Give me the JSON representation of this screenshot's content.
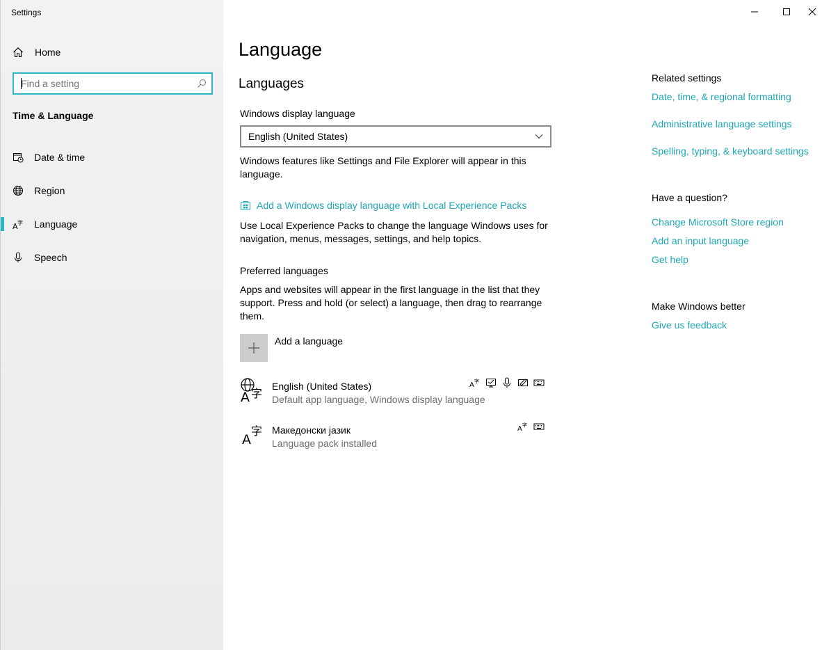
{
  "window": {
    "title": "Settings"
  },
  "sidebar": {
    "home_label": "Home",
    "search_placeholder": "Find a setting",
    "section_title": "Time & Language",
    "items": [
      {
        "label": "Date & time",
        "icon": "calendar-clock-icon"
      },
      {
        "label": "Region",
        "icon": "globe-icon"
      },
      {
        "label": "Language",
        "icon": "language-icon",
        "selected": true
      },
      {
        "label": "Speech",
        "icon": "microphone-icon"
      }
    ]
  },
  "main": {
    "page_title": "Language",
    "section_title": "Languages",
    "display_language": {
      "label": "Windows display language",
      "selected": "English (United States)",
      "description": "Windows features like Settings and File Explorer will appear in this language."
    },
    "local_experience": {
      "link": "Add a Windows display language with Local Experience Packs",
      "description": "Use Local Experience Packs to change the language Windows uses for navigation, menus, messages, settings, and help topics."
    },
    "preferred": {
      "label": "Preferred languages",
      "description": "Apps and websites will appear in the first language in the list that they support. Press and hold (or select) a language, then drag to rearrange them.",
      "add_label": "Add a language",
      "languages": [
        {
          "name": "English (United States)",
          "status": "Default app language, Windows display language"
        },
        {
          "name": "Македонски јазик",
          "status": "Language pack installed"
        }
      ]
    }
  },
  "related": {
    "title": "Related settings",
    "links": [
      "Date, time, & regional formatting",
      "Administrative language settings",
      "Spelling, typing, & keyboard settings"
    ]
  },
  "question": {
    "title": "Have a question?",
    "links": [
      "Change Microsoft Store region",
      "Add an input language",
      "Get help"
    ]
  },
  "feedback": {
    "title": "Make Windows better",
    "link": "Give us feedback"
  },
  "colors": {
    "accent": "#28b9c3",
    "link": "#1ea7b4"
  }
}
